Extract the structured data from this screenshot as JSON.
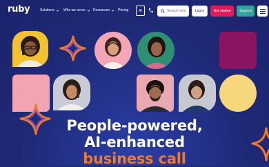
{
  "brand": {
    "logo_text": "ruby"
  },
  "nav": {
    "items": [
      {
        "label": "Solutions",
        "has_menu": true
      },
      {
        "label": "Who we serve",
        "has_menu": true
      },
      {
        "label": "Resources",
        "has_menu": true
      },
      {
        "label": "Pricing",
        "has_menu": false
      }
    ],
    "ai_label": "AI",
    "phone_icon": "phone-icon",
    "search": {
      "placeholder": "Search here",
      "icon": "search-icon"
    },
    "login_label": "Log in",
    "get_started_label": "Get started",
    "support_label": "Support",
    "menu_icon": "hamburger-icon"
  },
  "hero": {
    "headline_line1": "People-powered,",
    "headline_line2": "AI-enhanced",
    "headline_line3": "business call"
  },
  "colors": {
    "background": "#1f2a78",
    "accent_pink": "#e11a5a",
    "accent_teal": "#2fa59c",
    "accent_orange": "#f07a2b",
    "tile_magenta": "#8a1462",
    "tile_pink": "#f3a3b2",
    "tile_yellow": "#f7d77c"
  }
}
